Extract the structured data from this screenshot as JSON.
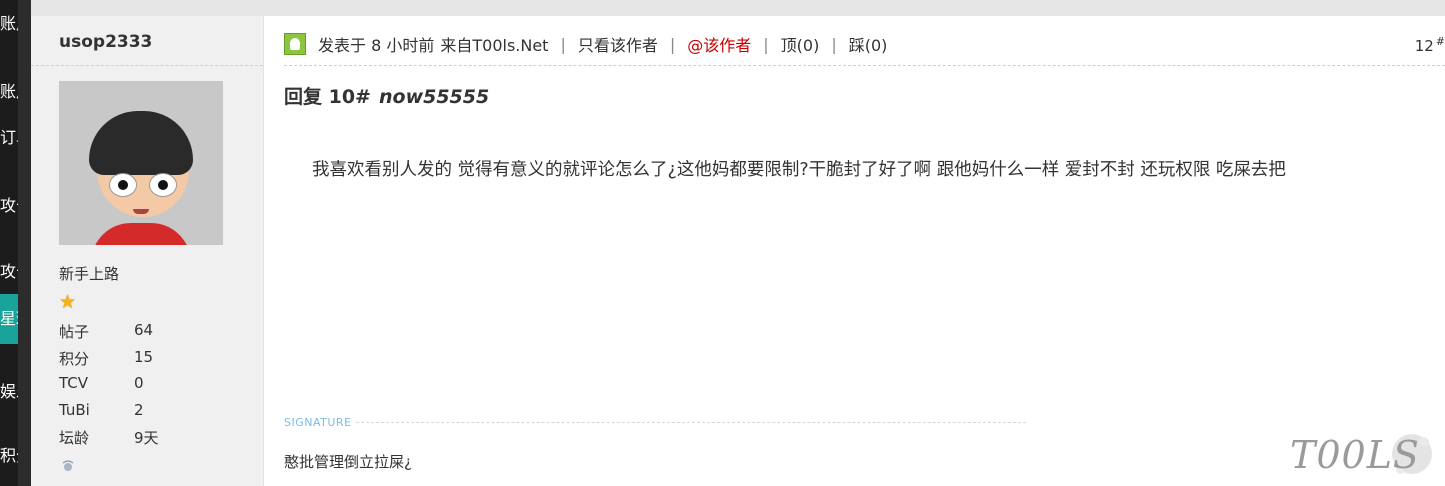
{
  "sidebar_fragments": [
    "账户",
    "账户",
    "订单",
    "攻击",
    "攻击",
    "星球",
    "娱乐",
    "积分"
  ],
  "author": {
    "name": "usop2333",
    "rank": "新手上路",
    "stats": [
      {
        "key": "帖子",
        "value": "64"
      },
      {
        "key": "积分",
        "value": "15"
      },
      {
        "key": "TCV",
        "value": "0"
      },
      {
        "key": "TuBi",
        "value": "2"
      },
      {
        "key": "坛龄",
        "value": "9天"
      }
    ]
  },
  "post": {
    "posted": "发表于 8 小时前",
    "source": "来自T00ls.Net",
    "only_author": "只看该作者",
    "at_author": "@该作者",
    "up": "顶(0)",
    "down": "踩(0)",
    "floor": "12",
    "floor_mark": "#",
    "reply_label": "回复 10#",
    "reply_user": "now55555",
    "content": "我喜欢看别人发的 觉得有意义的就评论怎么了¿这他妈都要限制?干脆封了好了啊 跟他妈什么一样 爱封不封 还玩权限 吃屎去把",
    "signature_label": "SIGNATURE",
    "signature": "憨批管理倒立拉屎¿"
  },
  "watermark": "T00LS",
  "colors": {
    "accent_red": "#cc0000",
    "sidebar_bg": "#1c1c1c",
    "sidebar_active": "#1aa39a",
    "signature_label": "#7dbde0",
    "online_icon": "#8cc63f"
  }
}
